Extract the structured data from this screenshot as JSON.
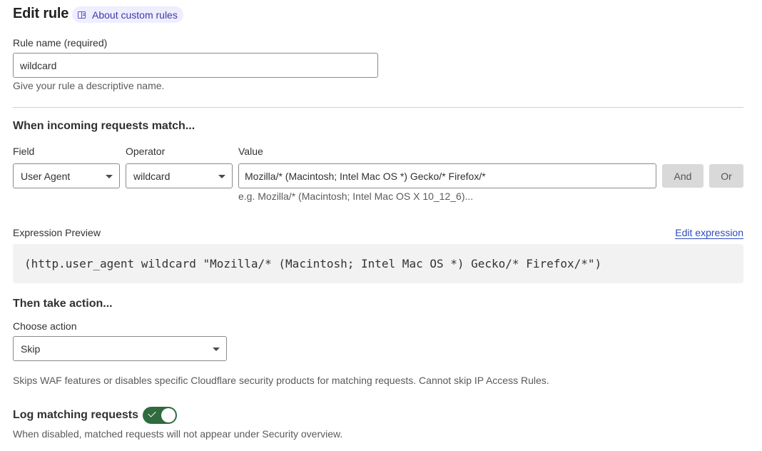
{
  "header": {
    "title": "Edit rule",
    "about_link": "About custom rules"
  },
  "rule_name": {
    "label": "Rule name (required)",
    "value": "wildcard",
    "help": "Give your rule a descriptive name."
  },
  "match": {
    "heading": "When incoming requests match...",
    "field_label": "Field",
    "field_value": "User Agent",
    "operator_label": "Operator",
    "operator_value": "wildcard",
    "value_label": "Value",
    "value_value": "Mozilla/* (Macintosh; Intel Mac OS *) Gecko/* Firefox/*",
    "value_example": "e.g. Mozilla/* (Macintosh; Intel Mac OS X 10_12_6)...",
    "and_button": "And",
    "or_button": "Or"
  },
  "expression": {
    "label": "Expression Preview",
    "edit_link": "Edit expression",
    "preview": "(http.user_agent wildcard \"Mozilla/* (Macintosh; Intel Mac OS *) Gecko/* Firefox/*\")"
  },
  "action": {
    "heading": "Then take action...",
    "choose_label": "Choose action",
    "selected": "Skip",
    "description": "Skips WAF features or disables specific Cloudflare security products for matching requests. Cannot skip IP Access Rules."
  },
  "logging": {
    "label": "Log matching requests",
    "enabled": true,
    "help": "When disabled, matched requests will not appear under Security overview."
  },
  "colors": {
    "link": "#2c4bbd",
    "toggle_on": "#2f6b3f",
    "pill_bg": "#eeeeff"
  }
}
